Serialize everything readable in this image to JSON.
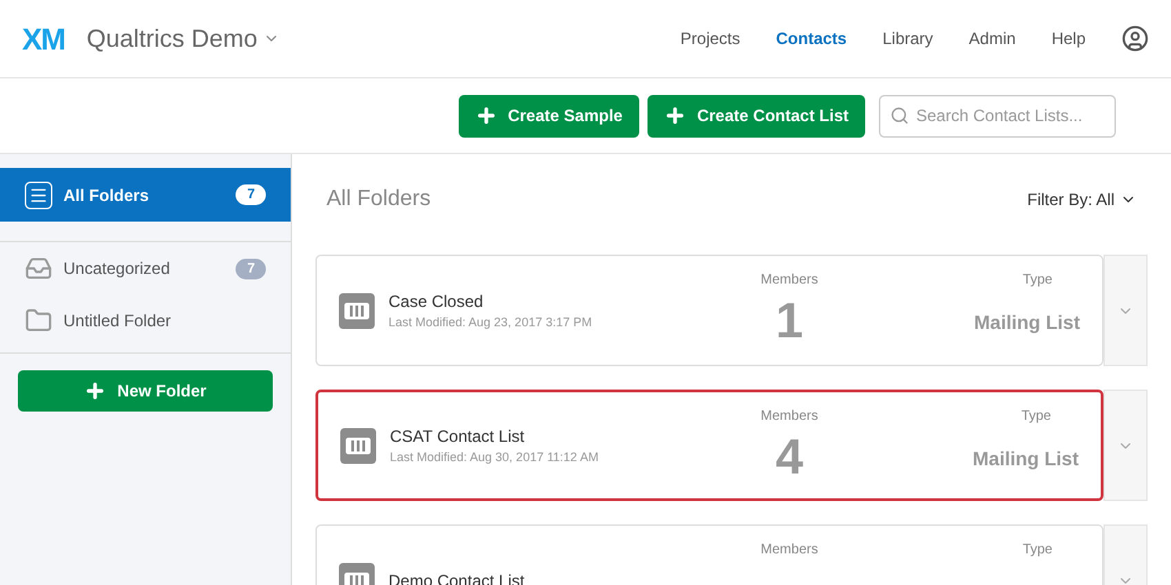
{
  "header": {
    "logo": "XM",
    "brand": "Qualtrics Demo",
    "nav": [
      {
        "label": "Projects",
        "selected": false
      },
      {
        "label": "Contacts",
        "selected": true
      },
      {
        "label": "Library",
        "selected": false
      },
      {
        "label": "Admin",
        "selected": false
      },
      {
        "label": "Help",
        "selected": false
      }
    ]
  },
  "toolbar": {
    "buttons": [
      "Create Sample",
      "Create Contact List"
    ],
    "search": {
      "placeholder": "Search Contact Lists..."
    }
  },
  "sidebar": {
    "items": [
      {
        "kind": "all",
        "label": "All Folders",
        "count": "7",
        "selected": true
      },
      {
        "kind": "uncategorized",
        "label": "Uncategorized",
        "count": "7",
        "selected": false
      },
      {
        "kind": "folder",
        "label": "Untitled Folder",
        "selected": false
      }
    ],
    "new_button": "New Folder"
  },
  "main": {
    "title": "All Folders",
    "filter": "Filter By: All",
    "lists": [
      {
        "name": "Case Closed",
        "modified": "Last Modified: Aug 23, 2017 3:17 PM",
        "members_label": "Members",
        "members": "1",
        "type_label": "Type",
        "type": "Mailing List",
        "highlighted": false
      },
      {
        "name": "CSAT Contact List",
        "modified": "Last Modified: Aug 30, 2017 11:12 AM",
        "members_label": "Members",
        "members": "4",
        "type_label": "Type",
        "type": "Mailing List",
        "highlighted": true
      },
      {
        "name": "Demo Contact List",
        "members_label": "Members",
        "type_label": "Type",
        "highlighted": false
      }
    ]
  }
}
